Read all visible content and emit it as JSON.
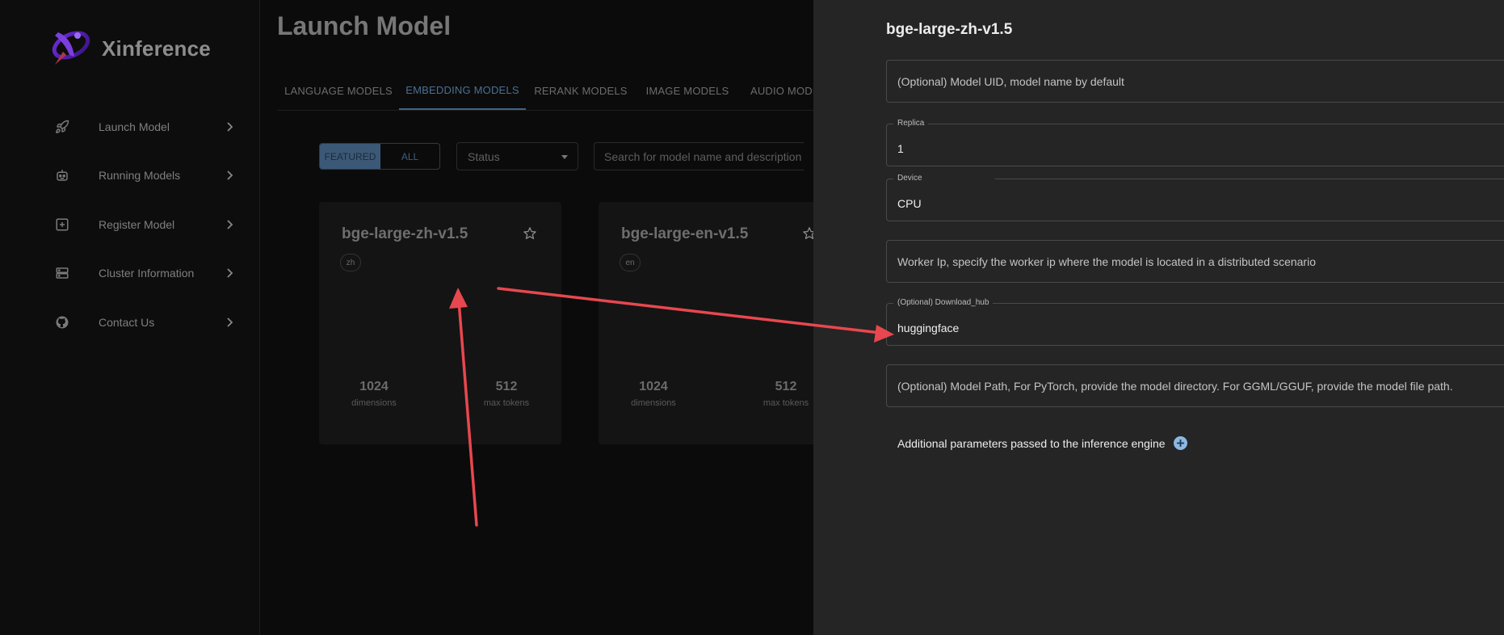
{
  "app": {
    "name": "Xinference"
  },
  "sidebar": {
    "items": [
      {
        "label": "Launch Model",
        "icon": "rocket-icon"
      },
      {
        "label": "Running Models",
        "icon": "robot-icon"
      },
      {
        "label": "Register Model",
        "icon": "add-box-icon"
      },
      {
        "label": "Cluster Information",
        "icon": "server-icon"
      },
      {
        "label": "Contact Us",
        "icon": "github-icon"
      }
    ]
  },
  "main": {
    "title": "Launch Model",
    "tabs": [
      {
        "label": "LANGUAGE MODELS"
      },
      {
        "label": "EMBEDDING MODELS"
      },
      {
        "label": "RERANK MODELS"
      },
      {
        "label": "IMAGE MODELS"
      },
      {
        "label": "AUDIO MODELS"
      }
    ],
    "filters": {
      "featured_label": "FEATURED",
      "all_label": "ALL",
      "status_label": "Status",
      "search_placeholder": "Search for model name and description"
    },
    "cards": [
      {
        "name": "bge-large-zh-v1.5",
        "tag": "zh",
        "dimensions": "1024",
        "dimensions_label": "dimensions",
        "max_tokens": "512",
        "max_tokens_label": "max tokens"
      },
      {
        "name": "bge-large-en-v1.5",
        "tag": "en",
        "dimensions": "1024",
        "dimensions_label": "dimensions",
        "max_tokens": "512",
        "max_tokens_label": "max tokens"
      }
    ]
  },
  "drawer": {
    "title": "bge-large-zh-v1.5",
    "model_uid": {
      "placeholder": "(Optional) Model UID, model name by default",
      "value": ""
    },
    "replica": {
      "label": "Replica",
      "value": "1"
    },
    "device": {
      "label": "Device",
      "value": "CPU"
    },
    "worker_ip": {
      "placeholder": "Worker Ip, specify the worker ip where the model is located in a distributed scenario",
      "value": ""
    },
    "download_hub": {
      "label": "(Optional) Download_hub",
      "value": "huggingface"
    },
    "model_path": {
      "placeholder": "(Optional) Model Path, For PyTorch, provide the model directory. For GGML/GGUF, provide the model file path.",
      "value": ""
    },
    "additional_params_label": "Additional parameters passed to the inference engine"
  },
  "colors": {
    "accent": "#3c5877",
    "annotation_arrow": "#e8474f",
    "drawer_bg": "#252525"
  }
}
